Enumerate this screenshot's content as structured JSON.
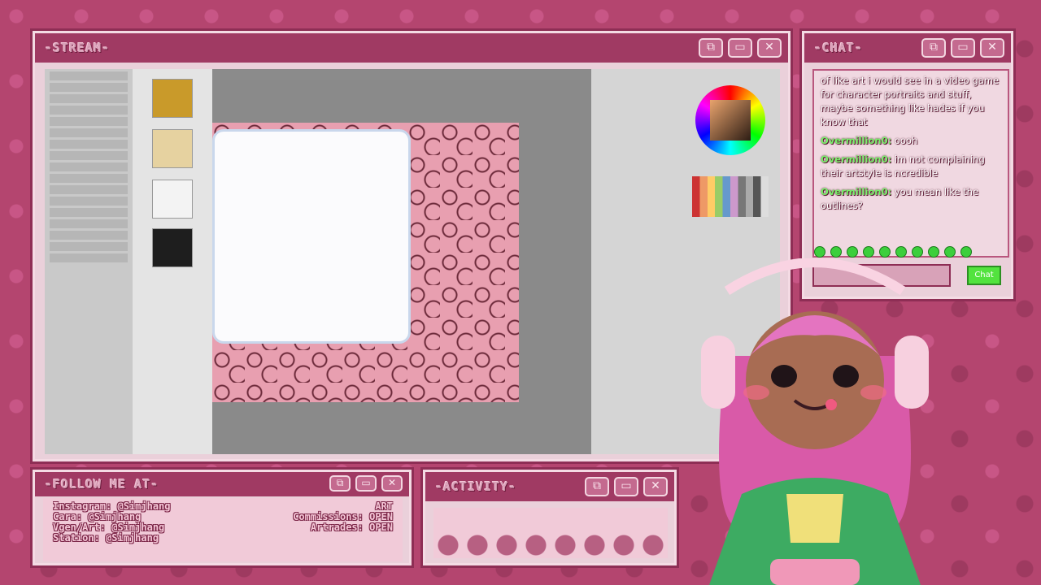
{
  "stream": {
    "title": "-STREAM-"
  },
  "chat": {
    "title": "-CHAT-",
    "messages": [
      {
        "user": "",
        "text": "of like art i would see in a video game for character portraits and stuff, maybe something like hades if you know that"
      },
      {
        "user": "Overmillion0:",
        "text": "oooh"
      },
      {
        "user": "Overmillion0:",
        "text": "im not complaining their artstyle is ncredible"
      },
      {
        "user": "Overmillion0:",
        "text": "you mean like the outlines?"
      }
    ],
    "chat_button": "Chat"
  },
  "follow": {
    "title": "-FOLLOW ME AT-",
    "rows": [
      {
        "left": "Instagram: @Simjhang",
        "right": "ART"
      },
      {
        "left": "Cara: @Simjhang",
        "right": "Commissions: OPEN"
      },
      {
        "left": "Vgen/Art: @Simjhang",
        "right": "Artrades: OPEN"
      },
      {
        "left": "Station: @Simjhang",
        "right": ""
      }
    ]
  },
  "activity": {
    "title": "-ACTIVITY-"
  },
  "window_buttons": {
    "restore": "⧉",
    "maximize": "▭",
    "close": "✕"
  },
  "colors": {
    "frame": "#a03a63",
    "panel_bg": "#ead0da",
    "accent_green": "#53e33e"
  }
}
